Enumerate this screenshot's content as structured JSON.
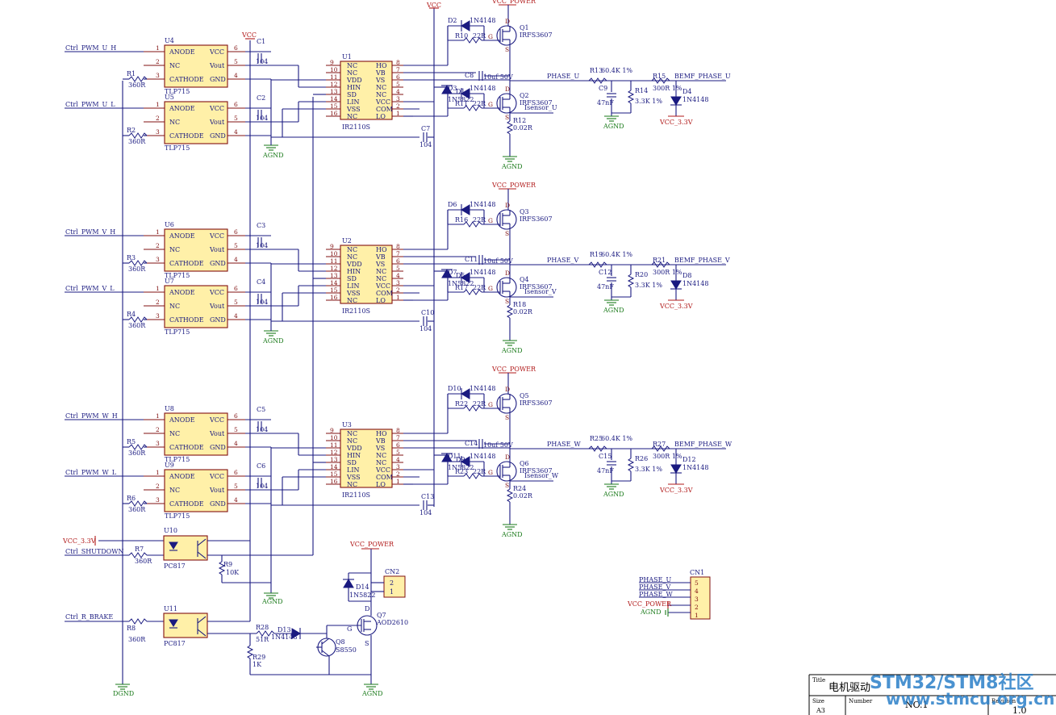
{
  "nets": {
    "u_h": "Ctrl_PWM_U_H",
    "u_l": "Ctrl_PWM_U_L",
    "v_h": "Ctrl_PWM_V_H",
    "v_l": "Ctrl_PWM_V_L",
    "w_h": "Ctrl_PWM_W_H",
    "w_l": "Ctrl_PWM_W_L",
    "vcc33": "VCC_3.3V",
    "shutdown": "Ctrl_SHUTDOWN",
    "brake": "Ctrl_R_BRAKE",
    "vcc": "VCC",
    "vcc_power": "VCC_POWER",
    "agnd": "AGND",
    "dgnd": "DGND",
    "phase_u": "PHASE_U",
    "phase_v": "PHASE_V",
    "phase_w": "PHASE_W",
    "bemf_u": "BEMF_PHASE_U",
    "bemf_v": "BEMF_PHASE_V",
    "bemf_w": "BEMF_PHASE_W",
    "vcc_3v3": "VCC_3.3V",
    "isense_u": "Isensor_U",
    "isense_v": "Isensor_V",
    "isense_w": "Isensor_W"
  },
  "optos": [
    {
      "ref": "U4",
      "part": "TLP715"
    },
    {
      "ref": "U5",
      "part": "TLP715"
    },
    {
      "ref": "U6",
      "part": "TLP715"
    },
    {
      "ref": "U7",
      "part": "TLP715"
    },
    {
      "ref": "U8",
      "part": "TLP715"
    },
    {
      "ref": "U9",
      "part": "TLP715"
    }
  ],
  "opto_pins": {
    "anode": "ANODE",
    "nc": "NC",
    "cathode": "CATHODE",
    "vcc": "VCC",
    "vout": "Vout",
    "gnd": "GND",
    "n1": "1",
    "n2": "2",
    "n3": "3",
    "n4": "4",
    "n5": "5",
    "n6": "6"
  },
  "input_resistors": [
    {
      "ref": "R1",
      "value": "360R"
    },
    {
      "ref": "R2",
      "value": "360R"
    },
    {
      "ref": "R3",
      "value": "360R"
    },
    {
      "ref": "R4",
      "value": "360R"
    },
    {
      "ref": "R5",
      "value": "360R"
    },
    {
      "ref": "R6",
      "value": "360R"
    }
  ],
  "decoupling": [
    {
      "ref": "C1",
      "value": "104"
    },
    {
      "ref": "C2",
      "value": "104"
    },
    {
      "ref": "C3",
      "value": "104"
    },
    {
      "ref": "C4",
      "value": "104"
    },
    {
      "ref": "C5",
      "value": "104"
    },
    {
      "ref": "C6",
      "value": "104"
    }
  ],
  "drivers": [
    {
      "ref": "U1",
      "part": "IR2110S"
    },
    {
      "ref": "U2",
      "part": "IR2110S"
    },
    {
      "ref": "U3",
      "part": "IR2110S"
    }
  ],
  "driver_pins_left": [
    "NC",
    "NC",
    "VDD",
    "HIN",
    "SD",
    "LIN",
    "VSS",
    "NC"
  ],
  "driver_pins_left_num": [
    "9",
    "10",
    "11",
    "12",
    "13",
    "14",
    "15",
    "16"
  ],
  "driver_pins_right": [
    "HO",
    "VB",
    "VS",
    "NC",
    "NC",
    "VCC",
    "COM",
    "LO"
  ],
  "driver_pins_right_num": [
    "8",
    "7",
    "6",
    "5",
    "4",
    "3",
    "2",
    "1"
  ],
  "phases": [
    {
      "boot_diode": "D1",
      "boot_diode_part": "1N5822",
      "boot_cap": "C8",
      "boot_cap_val": "10uf 50V",
      "vcc_cap": "C7",
      "vcc_cap_val": "104",
      "hi_diode": "D2",
      "lo_diode": "D3",
      "diode_part": "1N4148",
      "hi_res": "R10",
      "lo_res": "R11",
      "gate_val": "22R",
      "hi_fet": "Q1",
      "lo_fet": "Q2",
      "fet_part": "IRFS3607",
      "shunt": "R12",
      "shunt_val": "0.02R",
      "div_r1": "R13",
      "div_r1_val": "60.4K 1%",
      "div_r2": "R14",
      "div_r2_val": "3.3K 1%",
      "filt_c": "C9",
      "filt_c_val": "47nF",
      "clamp_r": "R15",
      "clamp_r_val": "300R 1%",
      "clamp_d": "D4",
      "clamp_d_part": "1N4148"
    },
    {
      "boot_diode": "D5",
      "boot_diode_part": "1N5822",
      "boot_cap": "C11",
      "boot_cap_val": "10uf 50V",
      "vcc_cap": "C10",
      "vcc_cap_val": "104",
      "hi_diode": "D6",
      "lo_diode": "D7",
      "diode_part": "1N4148",
      "hi_res": "R16",
      "lo_res": "R17",
      "gate_val": "22R",
      "hi_fet": "Q3",
      "lo_fet": "Q4",
      "fet_part": "IRFS3607",
      "shunt": "R18",
      "shunt_val": "0.02R",
      "div_r1": "R19",
      "div_r1_val": "60.4K 1%",
      "div_r2": "R20",
      "div_r2_val": "3.3K 1%",
      "filt_c": "C12",
      "filt_c_val": "47nF",
      "clamp_r": "R21",
      "clamp_r_val": "300R 1%",
      "clamp_d": "D8",
      "clamp_d_part": "1N4148"
    },
    {
      "boot_diode": "D9",
      "boot_diode_part": "1N5822",
      "boot_cap": "C14",
      "boot_cap_val": "10uf 50V",
      "vcc_cap": "C13",
      "vcc_cap_val": "104",
      "hi_diode": "D10",
      "lo_diode": "D11",
      "diode_part": "1N4148",
      "hi_res": "R22",
      "lo_res": "R23",
      "gate_val": "22R",
      "hi_fet": "Q5",
      "lo_fet": "Q6",
      "fet_part": "IRFS3607",
      "shunt": "R24",
      "shunt_val": "0.02R",
      "div_r1": "R25",
      "div_r1_val": "60.4K 1%",
      "div_r2": "R26",
      "div_r2_val": "3.3K 1%",
      "filt_c": "C15",
      "filt_c_val": "47nF",
      "clamp_r": "R27",
      "clamp_r_val": "300R 1%",
      "clamp_d": "D12",
      "clamp_d_part": "1N4148"
    }
  ],
  "fet_pins": {
    "d": "D",
    "g": "G",
    "s": "S"
  },
  "bottom": {
    "u10": "U10",
    "u11": "U11",
    "pc817": "PC817",
    "r7": "R7",
    "r7_val": "360R",
    "r8": "R8",
    "r8_val": "360R",
    "r9": "R9",
    "r9_val": "10K",
    "r28": "R28",
    "r28_val": "51R",
    "r29": "R29",
    "r29_val": "1K",
    "d13": "D13",
    "d13_part": "1N4148",
    "d14": "D14",
    "d14_part": "1N5822",
    "q7": "Q7",
    "q7_part": "AOD2610",
    "q8": "Q8",
    "q8_part": "S8550",
    "cn2": "CN2",
    "cn2_p2": "2",
    "cn2_p1": "1"
  },
  "cn1": {
    "ref": "CN1",
    "labels": [
      "PHASE_U",
      "PHASE_V",
      "PHASE_W",
      "VCC_POWER",
      "AGND"
    ],
    "pins": [
      "5",
      "4",
      "3",
      "2",
      "1"
    ]
  },
  "title_block": {
    "title_label": "Title",
    "title": "电机驱动",
    "size_label": "Size",
    "size": "A3",
    "number_label": "Number",
    "number": "NO.1",
    "rev_label": "Revision",
    "rev": "1.0"
  },
  "watermark": {
    "line1": "STM32/STM8社区",
    "line2": "www.stmcu.org.cn"
  }
}
